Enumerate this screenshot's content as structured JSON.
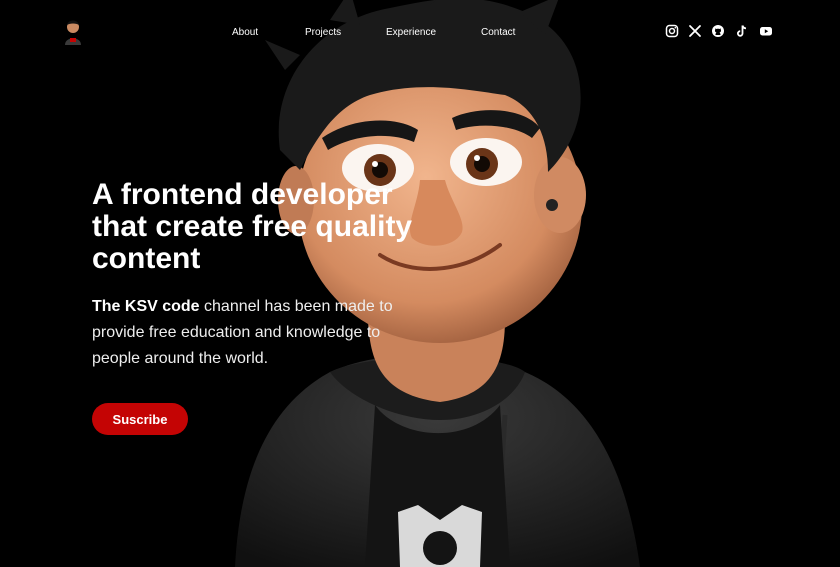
{
  "nav": {
    "links": [
      "About",
      "Projects",
      "Experience",
      "Contact"
    ],
    "social": [
      "instagram-icon",
      "x-icon",
      "github-icon",
      "tiktok-icon",
      "youtube-icon"
    ]
  },
  "hero": {
    "headline": "A frontend developer that create free quality content",
    "lead_strong": "The KSV code",
    "lead_rest": " channel has been made to provide free education and knowledge to people around the world.",
    "cta": "Suscribe"
  },
  "colors": {
    "background": "#000000",
    "accent": "#c40404",
    "text": "#ffffff"
  }
}
